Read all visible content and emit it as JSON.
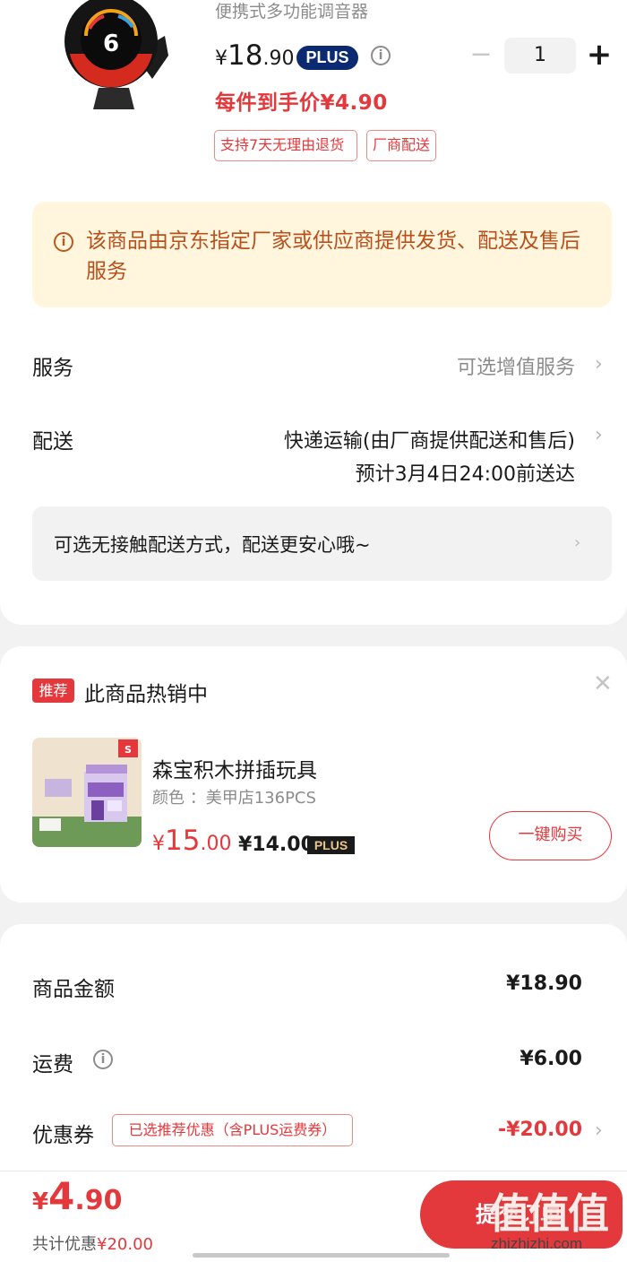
{
  "product": {
    "name": "便携式多功能调音器",
    "price_currency": "¥",
    "price_int": "18",
    "price_dec": ".90",
    "plus_label": "PLUS",
    "quantity": "1",
    "unit_price": "每件到手价¥4.90",
    "tags": [
      "支持7天无理由退货",
      "厂商配送"
    ]
  },
  "notice": {
    "text": "该商品由京东指定厂家或供应商提供发货、配送及售后服务"
  },
  "service": {
    "label": "服务",
    "value": "可选增值服务"
  },
  "delivery": {
    "label": "配送",
    "method": "快递运输(由厂商提供配送和售后)",
    "eta": "预计3月4日24:00前送达",
    "contactless": "可选无接触配送方式，配送更安心哦~"
  },
  "recommend": {
    "tag": "推荐",
    "title": "此商品热销中",
    "item_name": "森宝积木拼插玩具",
    "item_attr": "颜色 ：美甲店136PCS",
    "price_currency": "¥",
    "price_int": "15",
    "price_dec": ".00",
    "plus_price": "¥14.00",
    "plus_label": "PLUS",
    "buy_label": "一键购买"
  },
  "summary": {
    "goods_label": "商品金额",
    "goods_value": "¥18.90",
    "shipping_label": "运费",
    "shipping_value": "¥6.00",
    "coupon_label": "优惠券",
    "coupon_tag": "已选推荐优惠（含PLUS运费券）",
    "coupon_value": "-¥20.00"
  },
  "footer": {
    "total_currency": "¥",
    "total_int": "4",
    "total_dec": ".90",
    "saved_label": "共计优惠",
    "saved_value": "¥20.00",
    "submit_label": "提交订单",
    "watermark": "值值值",
    "watermark_url": "zhizhizhi.com"
  },
  "colors": {
    "accent_red": "#e4393c",
    "plus_navy": "#0c2a72",
    "notice_bg": "#fff6dd",
    "notice_text": "#b8501d"
  }
}
